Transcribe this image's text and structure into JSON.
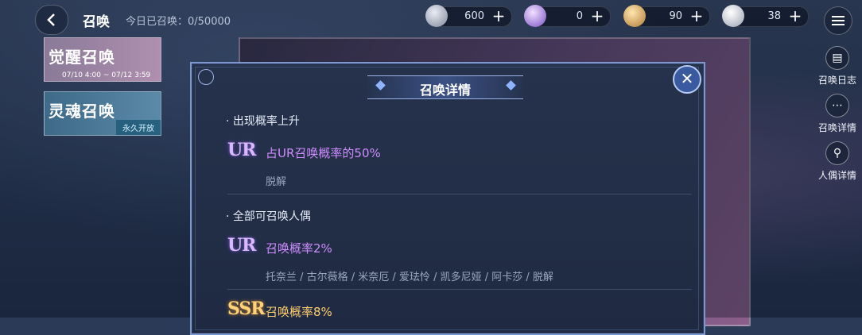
{
  "header": {
    "title": "召唤",
    "daily_label": "今日已召唤：0/50000"
  },
  "resources": [
    {
      "icon": "orb-icon",
      "value": "600",
      "color": "#9aa3b5"
    },
    {
      "icon": "crystal-icon",
      "value": "0",
      "color": "#c7a4ff"
    },
    {
      "icon": "feather-gold-icon",
      "value": "90",
      "color": "#e0b36a"
    },
    {
      "icon": "feather-silver-icon",
      "value": "38",
      "color": "#d9dde6"
    }
  ],
  "tabs": [
    {
      "name": "觉醒召唤",
      "dates": "07/10 4:00 ~ 07/12 3:59"
    },
    {
      "name": "灵魂召唤",
      "badge": "永久开放"
    }
  ],
  "side_buttons": [
    {
      "label": "召唤日志"
    },
    {
      "label": "召唤详情"
    },
    {
      "label": "人偶详情"
    }
  ],
  "modal": {
    "title": "召唤详情",
    "sections": [
      {
        "heading": "出现概率上升",
        "entries": [
          {
            "rarity": "UR",
            "rate": "占UR召唤概率的50%",
            "names": "脱解"
          }
        ]
      },
      {
        "heading": "全部可召唤人偶",
        "entries": [
          {
            "rarity": "UR",
            "rate": "召唤概率2%",
            "names": "托奈兰 / 古尔薇格 / 米奈厄 / 爱珐怜 / 凯多尼娅 / 阿卡莎 / 脱解"
          },
          {
            "rarity": "SSR",
            "rate": "召唤概率8%"
          }
        ]
      }
    ]
  },
  "colors": {
    "modal_border": "#7c98cf",
    "ur_rate": "#cf8dff",
    "ssr_rate": "#ffcf6e"
  }
}
